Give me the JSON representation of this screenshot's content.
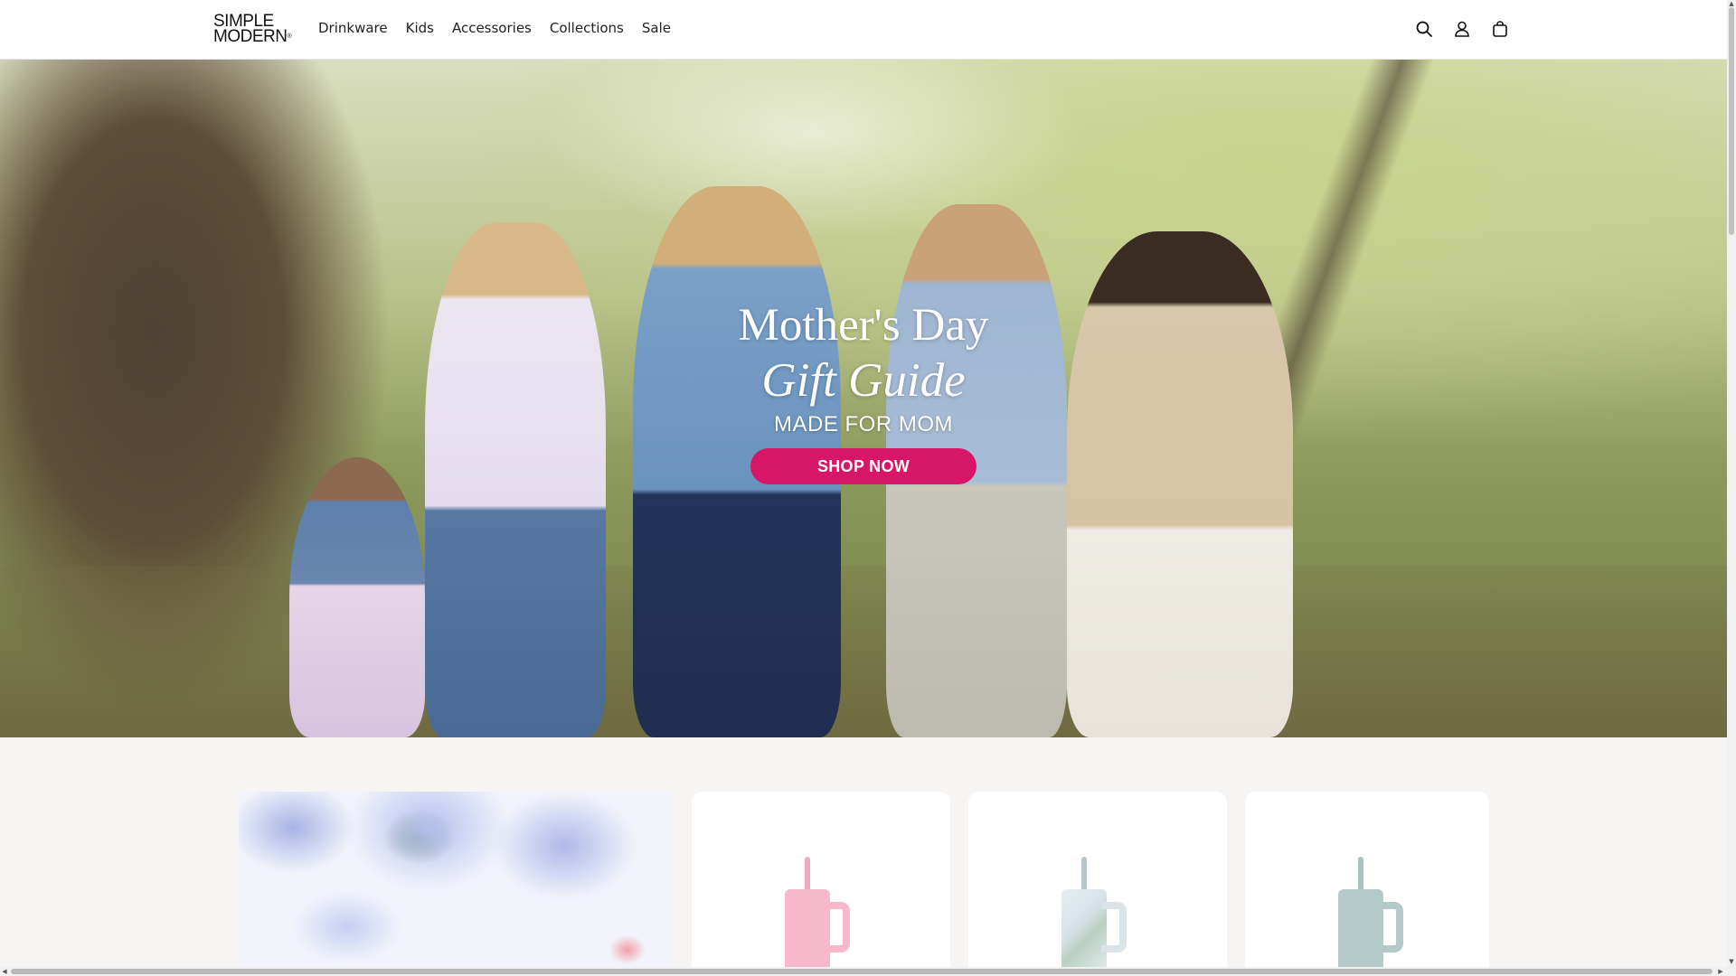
{
  "header": {
    "logo": {
      "line1": "SIMPLE",
      "line2": "MODERN",
      "mark": "®"
    },
    "nav": [
      "Drinkware",
      "Kids",
      "Accessories",
      "Collections",
      "Sale"
    ],
    "icons": [
      "search-icon",
      "account-icon",
      "cart-icon"
    ]
  },
  "hero": {
    "title": "Mother's Day",
    "subtitle": "Gift Guide",
    "kicker": "MADE FOR MOM",
    "cta": "SHOP NOW",
    "cta_color": "#d81667"
  },
  "products": [
    {
      "color_name": "pink",
      "straw_color": "#f1a9c0",
      "cup_color": "#f7b8cb"
    },
    {
      "color_name": "floral",
      "straw_color": "#b8c7cc",
      "cup_color": "#e3eaee"
    },
    {
      "color_name": "sage",
      "straw_color": "#a9c1bf",
      "cup_color": "#b4cac8"
    }
  ]
}
